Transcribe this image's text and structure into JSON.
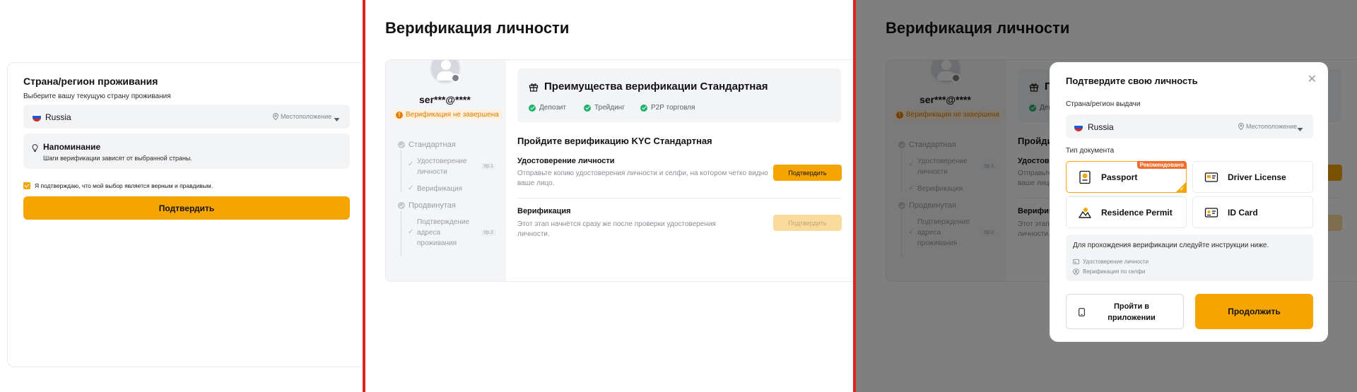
{
  "panel1": {
    "title": "Страна/регион проживания",
    "subtitle": "Выберите вашу текущую страну проживания",
    "country": "Russia",
    "location_label": "Местоположение",
    "reminder_title": "Напоминание",
    "reminder_text": "Шаги верификации зависят от выбранной страны.",
    "confirm_check_label": "Я подтверждаю, что мой выбор является верным и правдивым.",
    "confirm_button": "Подтвердить"
  },
  "kyc": {
    "page_title": "Верификация личности",
    "username": "ser***@****",
    "status": "Верификация не завершена",
    "levels": [
      {
        "label": "Стандартная",
        "substeps": [
          {
            "label": "Удостоверение личности",
            "level_tag": "Ур.1"
          },
          {
            "label": "Верификация",
            "level_tag": ""
          }
        ]
      },
      {
        "label": "Продвинутая",
        "substeps": [
          {
            "label": "Подтверждение адреса проживания",
            "level_tag": "Ур.2"
          }
        ]
      }
    ],
    "benefits_title": "Преимущества верификации Стандартная",
    "benefits": [
      "Депозит",
      "Трейдинг",
      "P2P торговля"
    ],
    "section_title": "Пройдите верификацию KYC Стандартная",
    "id_title": "Удостоверение личности",
    "id_desc": "Отправьте копию удостоверения личности и селфи, на котором четко видно ваше лицо.",
    "id_button": "Подтвердить",
    "verify_title": "Верификация",
    "verify_desc": "Этот этап начнётся сразу же после проверки удостоверения личности.",
    "verify_button": "Подтвердить"
  },
  "modal": {
    "title": "Подтвердите свою личность",
    "issuer_label": "Страна/регион выдачи",
    "country": "Russia",
    "location_label": "Местоположение",
    "doc_type_label": "Тип документа",
    "recommended_badge": "Рекомендовано",
    "documents": [
      {
        "label": "Passport",
        "icon": "passport-icon",
        "selected": true
      },
      {
        "label": "Driver License",
        "icon": "driver-license-icon",
        "selected": false
      },
      {
        "label": "Residence Permit",
        "icon": "residence-permit-icon",
        "selected": false
      },
      {
        "label": "ID Card",
        "icon": "id-card-icon",
        "selected": false
      }
    ],
    "instructions_main": "Для прохождения верификации следуйте инструкции ниже.",
    "instructions": [
      "Удостоверение личности",
      "Верификация по селфи"
    ],
    "app_button": "Пройти в приложении",
    "continue_button": "Продолжить"
  },
  "colors": {
    "accent": "#f5a400",
    "warning": "#e47c00",
    "success": "#20b26c",
    "divider": "#e0231f"
  }
}
